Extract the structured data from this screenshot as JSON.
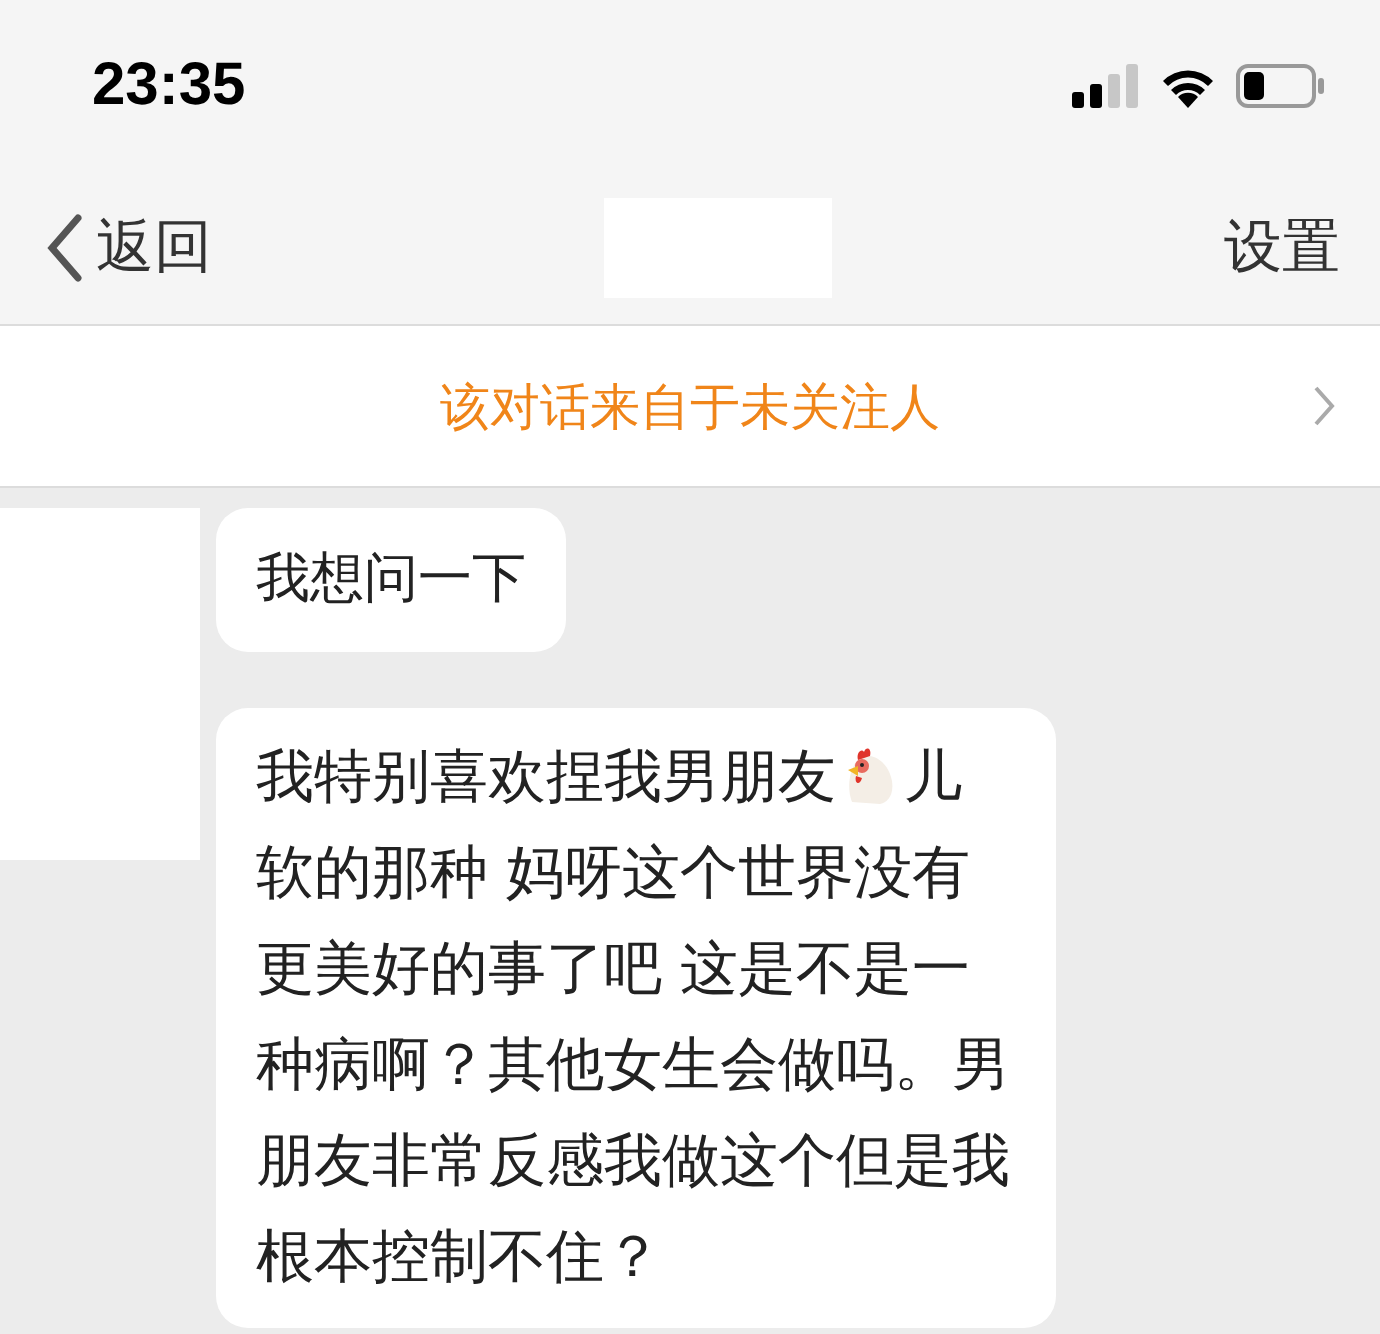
{
  "status_bar": {
    "time": "23:35"
  },
  "nav": {
    "back": "返回",
    "settings": "设置"
  },
  "banner": {
    "text": "该对话来自于未关注人"
  },
  "messages": [
    {
      "kind": "text",
      "text": "我想问一下"
    },
    {
      "kind": "icon_text",
      "before": "我特别喜欢捏我男朋友",
      "after": "儿",
      "lines": [
        "软的那种 妈呀这个世界没有",
        "更美好的事了吧 这是不是一",
        "种病啊？其他女生会做吗。男",
        "朋友非常反感我做这个但是我",
        "根本控制不住？"
      ]
    }
  ]
}
